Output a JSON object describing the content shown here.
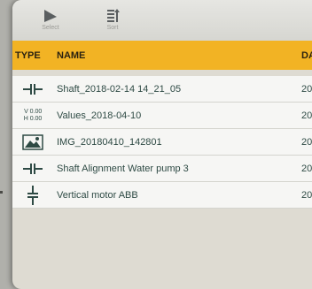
{
  "toolbar": {
    "select_label": "Select",
    "sort_label": "Sort"
  },
  "table": {
    "columns": [
      "TYPE",
      "NAME",
      "DA"
    ],
    "rows": [
      {
        "type_icon": "horizontal-shaft-icon",
        "name": "Shaft_2018-02-14 14_21_05",
        "date": "20"
      },
      {
        "type_icon": "values-icon",
        "type_text_v": "V 0.00",
        "type_text_h": "H 0.00",
        "name": "Values_2018-04-10",
        "date": "20"
      },
      {
        "type_icon": "image-icon",
        "name": "IMG_20180410_142801",
        "date": "20"
      },
      {
        "type_icon": "horizontal-shaft-icon",
        "name": "Shaft Alignment Water pump 3",
        "date": "20"
      },
      {
        "type_icon": "vertical-shaft-icon",
        "name": "Vertical motor ABB",
        "date": "20"
      }
    ]
  },
  "colors": {
    "header": "#f2b324",
    "row_text": "#2e4a44",
    "panel": "#dedbd2"
  }
}
